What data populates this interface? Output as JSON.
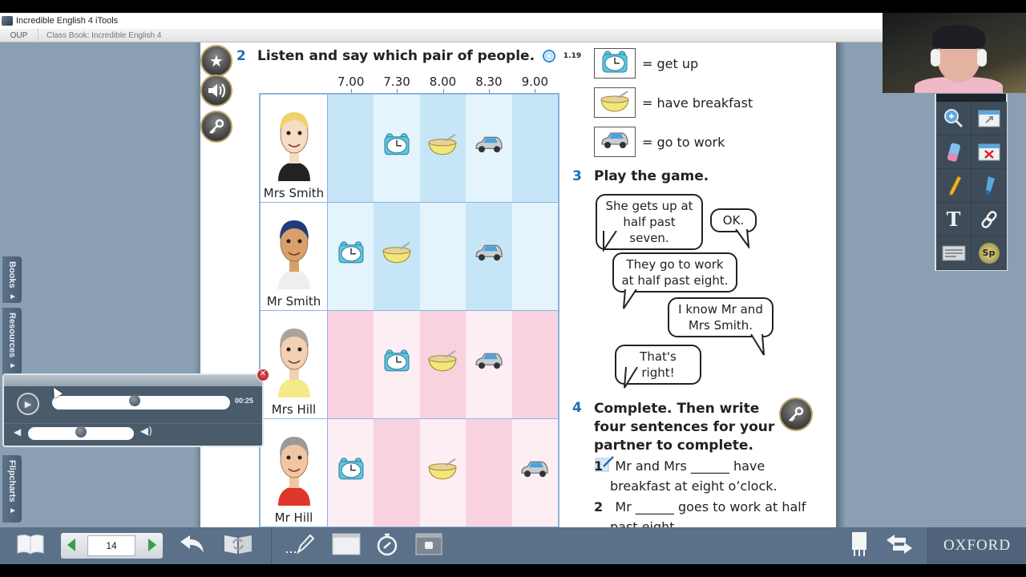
{
  "window": {
    "title": "Incredible English 4 iTools",
    "tabs": [
      {
        "label": "OUP"
      },
      {
        "label": "Class Book: Incredible English 4"
      }
    ]
  },
  "page_side_buttons": [
    {
      "icon": "star-icon"
    },
    {
      "icon": "speaker-icon"
    },
    {
      "icon": "key-icon"
    }
  ],
  "exercise2": {
    "number": "2",
    "title": "Listen and say which pair of people.",
    "audio_icon": "cd-icon",
    "track": "1.19",
    "times": [
      "7.00",
      "7.30",
      "8.00",
      "8.30",
      "9.00"
    ],
    "people": [
      {
        "name": "Mrs Smith",
        "get_up": "7.30",
        "have_breakfast": "8.00",
        "go_to_work": "8.30"
      },
      {
        "name": "Mr Smith",
        "get_up": "7.00",
        "have_breakfast": "7.30",
        "go_to_work": "8.30"
      },
      {
        "name": "Mrs Hill",
        "get_up": "7.30",
        "have_breakfast": "8.00",
        "go_to_work": "8.30"
      },
      {
        "name": "Mr Hill",
        "get_up": "7.00",
        "have_breakfast": "8.00",
        "go_to_work": "9.00"
      }
    ]
  },
  "legend": [
    {
      "icon": "alarm-clock-icon",
      "label": "= get up"
    },
    {
      "icon": "cereal-bowl-icon",
      "label": "= have breakfast"
    },
    {
      "icon": "car-icon",
      "label": "= go to work"
    }
  ],
  "exercise3": {
    "number": "3",
    "title": "Play the game.",
    "bubbles": [
      {
        "text": "She gets up at half past seven."
      },
      {
        "text": "OK."
      },
      {
        "text": "They go to work at half past eight."
      },
      {
        "text": "I know Mr and Mrs Smith."
      },
      {
        "text": "That's right!"
      }
    ]
  },
  "exercise4": {
    "number": "4",
    "title": "Complete. Then write four sentences for your partner to complete.",
    "items": [
      {
        "num": "1",
        "text_a": "Mr and Mrs",
        "blank": "______",
        "text_b": "have",
        "line2": "breakfast at eight o’clock."
      },
      {
        "num": "2",
        "text_a": "Mr",
        "blank": "______",
        "text_b": "goes to work at half",
        "line2": "past eight."
      }
    ]
  },
  "side_tabs": [
    {
      "label": "Books"
    },
    {
      "label": "Resources"
    },
    {
      "label": "Flipcharts"
    }
  ],
  "audio_player": {
    "time": "00:25",
    "progress": 0.46,
    "volume": 0.5
  },
  "tool_palette": [
    {
      "name": "zoom-tool",
      "icon": "magnifier-icon"
    },
    {
      "name": "fullscreen-tool",
      "icon": "expand-window-icon"
    },
    {
      "name": "eraser-tool",
      "icon": "eraser-icon"
    },
    {
      "name": "clear-tool",
      "icon": "close-window-icon"
    },
    {
      "name": "pencil-tool",
      "icon": "pencil-icon"
    },
    {
      "name": "highlighter-tool",
      "icon": "highlighter-icon"
    },
    {
      "name": "text-tool",
      "icon": "text-icon",
      "glyph": "T"
    },
    {
      "name": "link-tool",
      "icon": "chain-link-icon"
    },
    {
      "name": "notes-tool",
      "icon": "notepad-icon"
    },
    {
      "name": "spotlight-tool",
      "icon": "spotlight-icon",
      "glyph": "Sp"
    }
  ],
  "bottom_bar": {
    "page_number": "14",
    "brand": "OXFORD"
  },
  "colors": {
    "workspace_bg": "#8a9fb1",
    "toolbar_bg": "#5a7189",
    "exercise_number": "#1d6fb8",
    "grid_border": "#8fb2de",
    "blue_dark": "#c6e6f7",
    "blue_light": "#e4f4fc",
    "pink_dark": "#f9d2e0",
    "pink_light": "#fdeef4"
  }
}
